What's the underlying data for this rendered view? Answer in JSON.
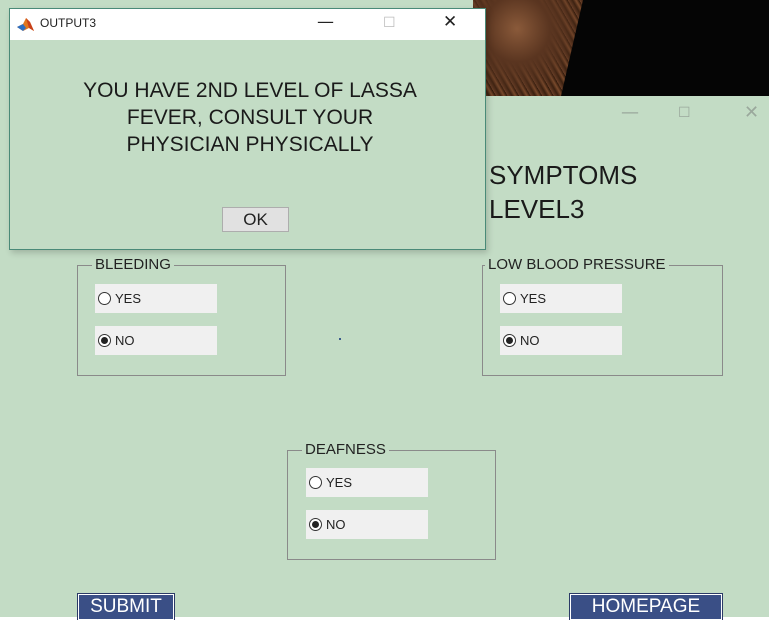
{
  "main_window": {
    "heading_line1": "SYMPTOMS",
    "heading_line2": "LEVEL3",
    "controls": {
      "minimize": "—",
      "maximize": "☐",
      "close": "✕"
    }
  },
  "groups": {
    "bleeding": {
      "title": "BLEEDING",
      "yes": "YES",
      "no": "NO",
      "selected": "NO"
    },
    "low_blood_pressure": {
      "title": "LOW BLOOD PRESSURE",
      "yes": "YES",
      "no": "NO",
      "selected": "NO"
    },
    "deafness": {
      "title": "DEAFNESS",
      "yes": "YES",
      "no": "NO",
      "selected": "NO"
    }
  },
  "buttons": {
    "submit": "SUBMIT",
    "homepage": "HOMEPAGE"
  },
  "dialog": {
    "title": "OUTPUT3",
    "message_line1": "YOU HAVE 2ND LEVEL OF LASSA",
    "message_line2": "FEVER, CONSULT YOUR",
    "message_line3": "PHYSICIAN PHYSICALLY",
    "ok": "OK",
    "controls": {
      "minimize": "—",
      "maximize": "☐",
      "close": "✕"
    }
  },
  "colors": {
    "window_bg": "#c3dcc5",
    "button_blue": "#3a4f86",
    "radio_bg": "#f0f0f0"
  }
}
